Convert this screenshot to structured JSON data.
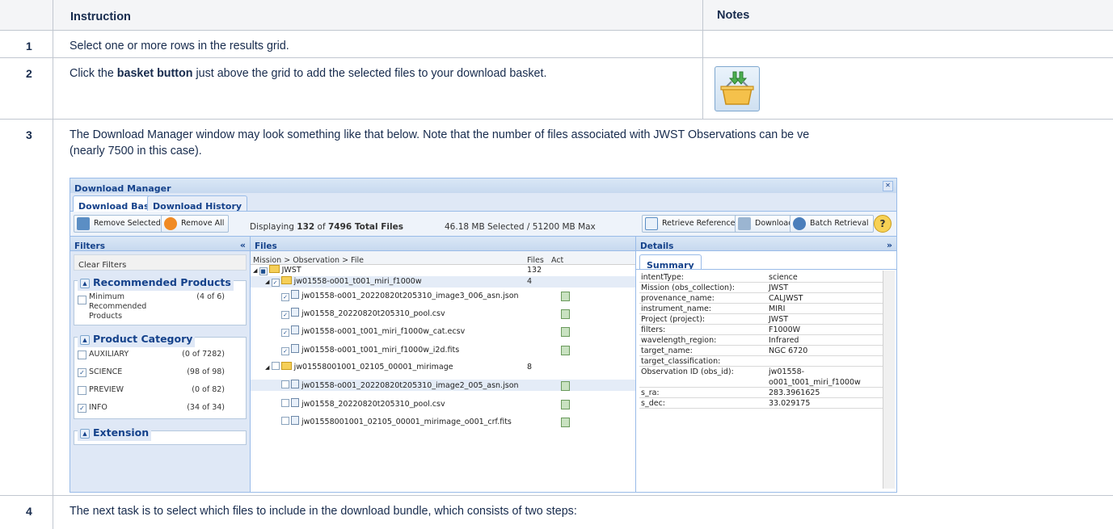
{
  "table": {
    "header": {
      "num": "",
      "instruction": "Instruction",
      "notes": "Notes"
    },
    "rows": [
      {
        "num": "1",
        "text": "Select one or more rows in the results grid."
      },
      {
        "num": "2",
        "text_pre": "Click the ",
        "text_bold": "basket button",
        "text_post": " just above the grid to add the selected files to your download basket."
      },
      {
        "num": "3",
        "line1": "The Download Manager window may look something like that below. Note that the number of files associated with JWST Observations can  be ve",
        "line2": "(nearly 7500 in this case)."
      },
      {
        "num": "4",
        "text": "The next task is to select which files to include in the download bundle, which consists of two steps:"
      }
    ]
  },
  "basket_icon": {
    "icon": "download-basket-icon",
    "colors": {
      "basket": "#f5c14b",
      "arrows": "#4caf50"
    }
  },
  "download_manager": {
    "title": "Download Manager",
    "tabs": [
      "Download Basket",
      "Download History"
    ],
    "toolbar": {
      "remove_selected": "Remove Selected",
      "remove_all": "Remove All",
      "displaying_pre": "Displaying ",
      "displaying_count": "132",
      "displaying_mid": " of ",
      "displaying_total": "7496 Total Files",
      "selected_size": "46.18 MB Selected / 51200 MB Max",
      "retrieve_references": "Retrieve References",
      "download": "Download",
      "batch_retrieval": "Batch Retrieval",
      "help": "?"
    },
    "filters": {
      "title": "Filters",
      "clear": "Clear Filters",
      "groups": [
        {
          "title": "Recommended Products",
          "items": [
            {
              "label": "Minimum Recommended Products",
              "count": "(4 of 6)",
              "checked": false
            }
          ]
        },
        {
          "title": "Product Category",
          "items": [
            {
              "label": "AUXILIARY",
              "count": "(0 of 7282)",
              "checked": false
            },
            {
              "label": "SCIENCE",
              "count": "(98 of 98)",
              "checked": true
            },
            {
              "label": "PREVIEW",
              "count": "(0 of 82)",
              "checked": false
            },
            {
              "label": "INFO",
              "count": "(34 of 34)",
              "checked": true
            }
          ]
        },
        {
          "title": "Extension",
          "items": []
        }
      ]
    },
    "files": {
      "title": "Files",
      "columns": [
        "Mission > Observation > File",
        "Files",
        "Act"
      ],
      "rows": [
        {
          "name": "JWST",
          "count": "132",
          "level": 0,
          "type": "folder",
          "check": "partial",
          "selected": false
        },
        {
          "name": "jw01558-o001_t001_miri_f1000w",
          "count": "4",
          "level": 1,
          "type": "folder",
          "check": "checked",
          "selected": true
        },
        {
          "name": "jw01558-o001_20220820t205310_image3_006_asn.json",
          "count": "",
          "level": 2,
          "type": "file",
          "check": "checked",
          "selected": false
        },
        {
          "name": "jw01558_20220820t205310_pool.csv",
          "count": "",
          "level": 2,
          "type": "file",
          "check": "checked",
          "selected": false
        },
        {
          "name": "jw01558-o001_t001_miri_f1000w_cat.ecsv",
          "count": "",
          "level": 2,
          "type": "file",
          "check": "checked",
          "selected": false
        },
        {
          "name": "jw01558-o001_t001_miri_f1000w_i2d.fits",
          "count": "",
          "level": 2,
          "type": "file",
          "check": "checked",
          "selected": false
        },
        {
          "name": "jw01558001001_02105_00001_mirimage",
          "count": "8",
          "level": 1,
          "type": "folder",
          "check": "unchecked",
          "selected": false
        },
        {
          "name": "jw01558-o001_20220820t205310_image2_005_asn.json",
          "count": "",
          "level": 2,
          "type": "file",
          "check": "unchecked",
          "selected": true
        },
        {
          "name": "jw01558_20220820t205310_pool.csv",
          "count": "",
          "level": 2,
          "type": "file",
          "check": "unchecked",
          "selected": false
        },
        {
          "name": "jw01558001001_02105_00001_mirimage_o001_crf.fits",
          "count": "",
          "level": 2,
          "type": "file",
          "check": "unchecked",
          "selected": false
        }
      ]
    },
    "details": {
      "title": "Details",
      "tab": "Summary",
      "rows": [
        {
          "key": "intentType:",
          "value": "science"
        },
        {
          "key": "Mission (obs_collection):",
          "value": "JWST"
        },
        {
          "key": "provenance_name:",
          "value": "CALJWST"
        },
        {
          "key": "instrument_name:",
          "value": "MIRI"
        },
        {
          "key": "Project (project):",
          "value": "JWST"
        },
        {
          "key": "filters:",
          "value": "F1000W"
        },
        {
          "key": "wavelength_region:",
          "value": "Infrared"
        },
        {
          "key": "target_name:",
          "value": "NGC 6720"
        },
        {
          "key": "target_classification:",
          "value": ""
        },
        {
          "key": "Observation ID (obs_id):",
          "value": "jw01558-o001_t001_miri_f1000w"
        },
        {
          "key": "s_ra:",
          "value": "283.3961625"
        },
        {
          "key": "s_dec:",
          "value": "33.029175"
        }
      ]
    }
  }
}
